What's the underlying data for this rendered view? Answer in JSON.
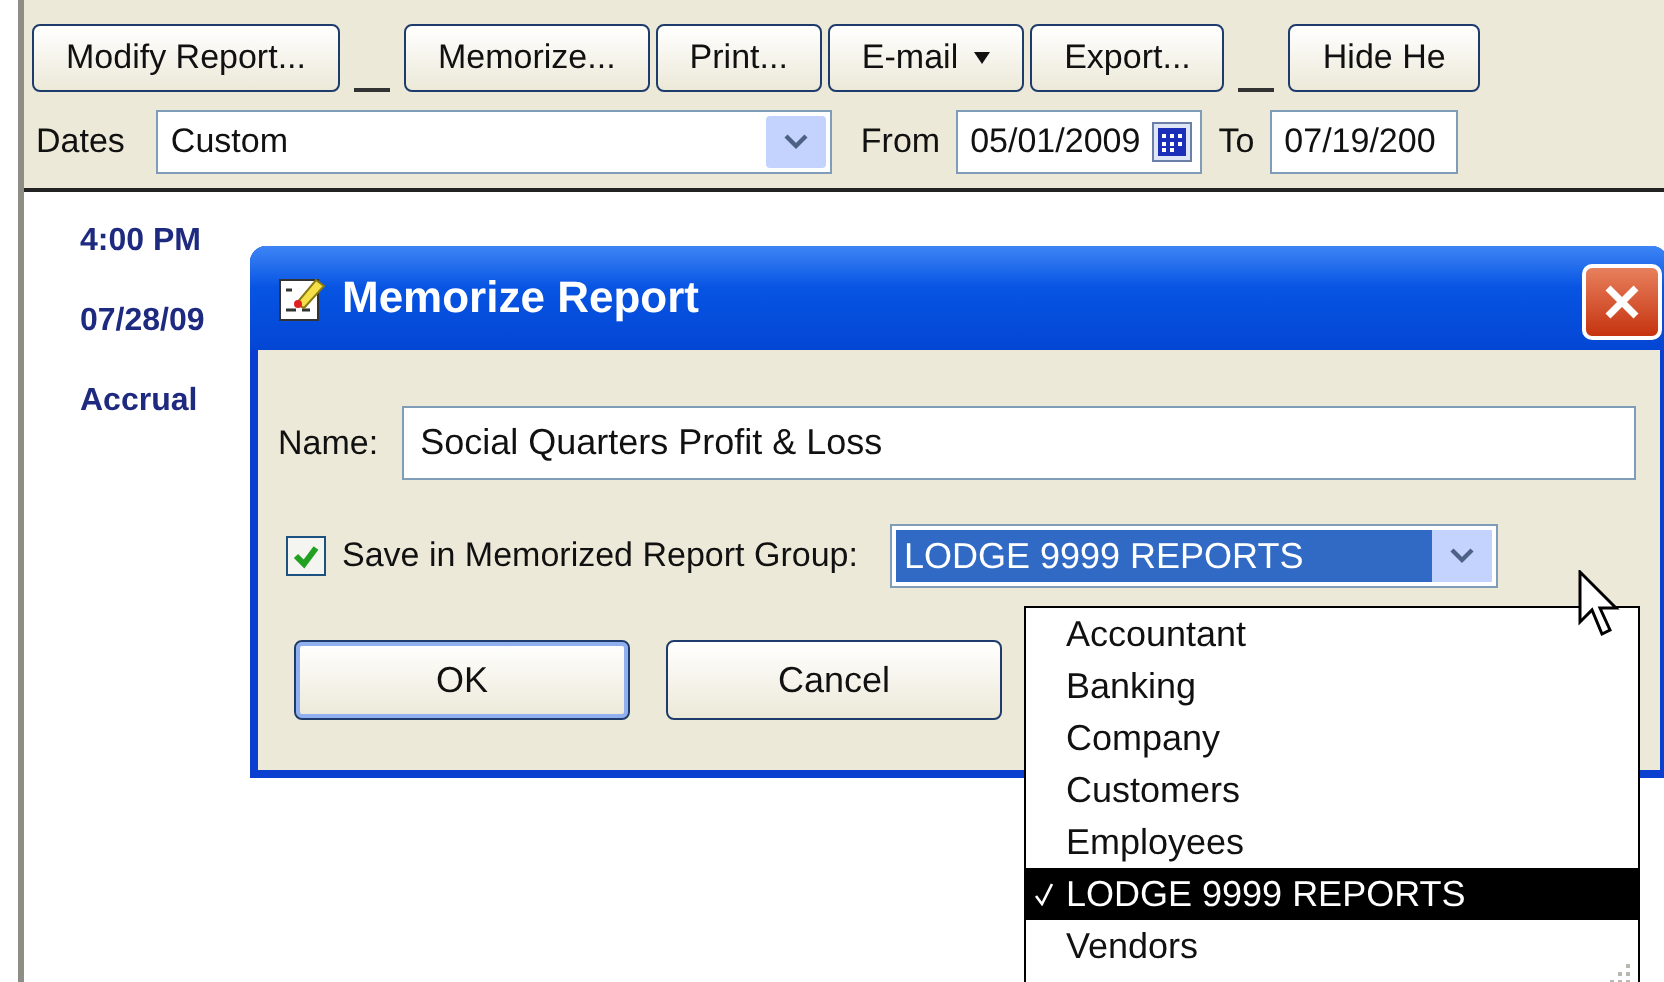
{
  "toolbar": {
    "buttons": [
      {
        "label": "Modify Report...",
        "kind": "button",
        "separator_after": true
      },
      {
        "label": "Memorize...",
        "kind": "button",
        "separator_after": false
      },
      {
        "label": "Print...",
        "kind": "button",
        "separator_after": false
      },
      {
        "label": "E-mail",
        "kind": "menu",
        "separator_after": false
      },
      {
        "label": "Export...",
        "kind": "button",
        "separator_after": true
      },
      {
        "label": "Hide He",
        "kind": "button",
        "separator_after": false
      }
    ]
  },
  "dates_bar": {
    "dates_label": "Dates",
    "dates_value": "Custom",
    "from_label": "From",
    "from_value": "05/01/2009",
    "to_label": "To",
    "to_value": "07/19/200"
  },
  "report": {
    "lines": [
      "4:00 PM",
      "07/28/09",
      "Accrual"
    ]
  },
  "dialog": {
    "title": "Memorize Report",
    "name_label": "Name:",
    "name_value": "Social Quarters Profit & Loss",
    "save_group": {
      "label": "Save in Memorized Report Group:",
      "checked": true
    },
    "group_value": "LODGE 9999 REPORTS",
    "buttons": [
      "OK",
      "Cancel"
    ],
    "dropdown": {
      "items": [
        {
          "label": "Accountant",
          "selected": false
        },
        {
          "label": "Banking",
          "selected": false
        },
        {
          "label": "Company",
          "selected": false
        },
        {
          "label": "Customers",
          "selected": false
        },
        {
          "label": "Employees",
          "selected": false
        },
        {
          "label": "LODGE 9999 REPORTS",
          "selected": true
        },
        {
          "label": "Vendors",
          "selected": false
        }
      ]
    }
  }
}
